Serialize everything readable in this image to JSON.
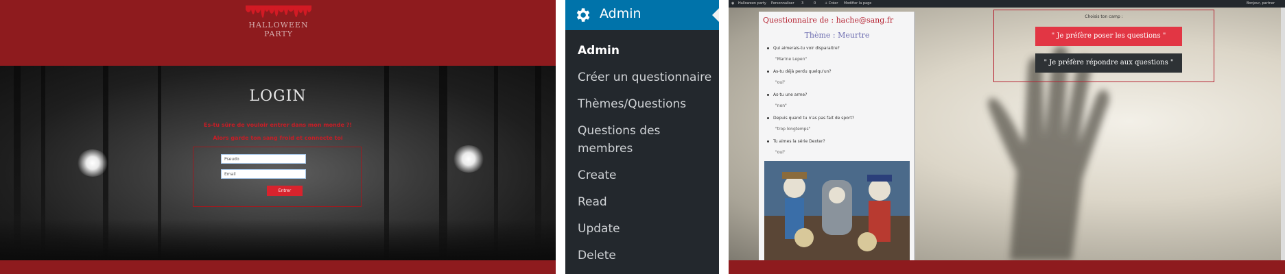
{
  "login": {
    "logo_text": "HALLOWEEN PARTY",
    "tagline": "",
    "header_links": [
      "",
      ""
    ],
    "title": "LOGIN",
    "question_1": "Es-tu sûre de vouloir entrer dans mon monde ?!",
    "question_2": "Alors garde ton sang froid et connecte toi",
    "pseudo_placeholder": "Pseudo",
    "email_placeholder": "Email",
    "submit_label": "Entrer",
    "footer_text": "",
    "footer_link": "",
    "accent": "#8e1b1e",
    "button_color": "#d8232d"
  },
  "admin_menu": {
    "header": "Admin",
    "items": [
      {
        "label": "Admin",
        "active": true
      },
      {
        "label": "Créer un questionnaire"
      },
      {
        "label": "Thèmes/Questions"
      },
      {
        "label": "Questions des",
        "label2": "membres"
      },
      {
        "label": "Create"
      },
      {
        "label": "Read"
      },
      {
        "label": "Update"
      },
      {
        "label": "Delete"
      }
    ],
    "header_color": "#0073aa",
    "background": "#23282d"
  },
  "quiz": {
    "adminbar": [
      "Halloween party",
      "Personnaliser",
      "3",
      "0",
      "+ Créer",
      "Modifier la page",
      "Bonjour, partner"
    ],
    "title": "Questionnaire de : hache@sang.fr",
    "theme": "Thème : Meurtre",
    "qa": [
      {
        "q": "Qui aimerais-tu voir disparaitre?",
        "a": "\"Marine Lepen\""
      },
      {
        "q": "As-tu déjà perdu quelqu'un?",
        "a": "\"oui\""
      },
      {
        "q": "As-tu une arme?",
        "a": "\"non\""
      },
      {
        "q": "Depuis quand tu n'as pas fait de sport?",
        "a": "\"trop longtemps\""
      },
      {
        "q": "Tu aimes la série Dexter?",
        "a": "\"oui\""
      }
    ],
    "choice_label": "Choisis ton camp :",
    "choice_1": "\" Je préfère poser les questions \"",
    "choice_2": "\" Je préfère répondre aux questions \"",
    "footer_text": "",
    "footer_link": ""
  }
}
